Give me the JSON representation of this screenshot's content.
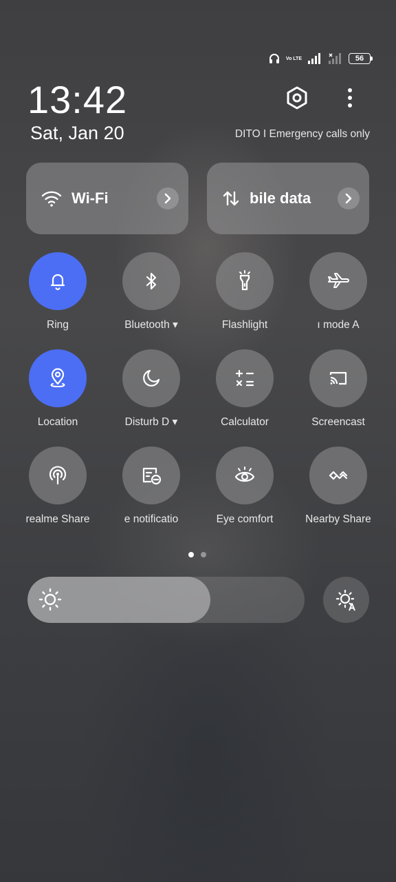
{
  "status_bar": {
    "icons": [
      "headphones-icon",
      "volte-icon",
      "signal-icon",
      "no-signal-icon",
      "battery-icon"
    ],
    "volte_text": "Vo LTE",
    "battery": "56"
  },
  "header": {
    "time": "13:42",
    "date": "Sat, Jan 20",
    "carrier": "DITO I Emergency calls only"
  },
  "big_tiles": [
    {
      "label": "Wi-Fi",
      "icon": "wifi-icon"
    },
    {
      "label": "bile data",
      "icon": "mobile-data-icon"
    }
  ],
  "tiles": [
    {
      "label": "Ring",
      "icon": "bell-icon",
      "active": true
    },
    {
      "label": "Bluetooth ▾",
      "icon": "bluetooth-icon",
      "active": false
    },
    {
      "label": "Flashlight",
      "icon": "flashlight-icon",
      "active": false
    },
    {
      "label": "ı mode   A",
      "icon": "airplane-icon",
      "active": false
    },
    {
      "label": "Location",
      "icon": "location-icon",
      "active": true
    },
    {
      "label": "Disturb   D ▾",
      "icon": "moon-icon",
      "active": false
    },
    {
      "label": "Calculator",
      "icon": "calculator-icon",
      "active": false
    },
    {
      "label": "Screencast",
      "icon": "screencast-icon",
      "active": false
    },
    {
      "label": "realme Share",
      "icon": "realme-share-icon",
      "active": false
    },
    {
      "label": "e notificatio",
      "icon": "notification-icon",
      "active": false
    },
    {
      "label": "Eye comfort",
      "icon": "eye-icon",
      "active": false
    },
    {
      "label": "Nearby Share",
      "icon": "nearby-share-icon",
      "active": false
    }
  ],
  "pager": {
    "current": 1,
    "total": 2
  },
  "brightness": {
    "level": 0.66
  },
  "colors": {
    "active_tile": "#4c6ef5"
  }
}
